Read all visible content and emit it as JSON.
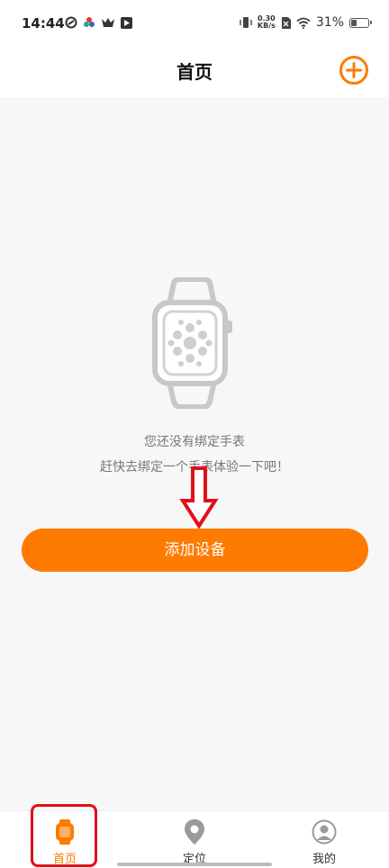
{
  "status_bar": {
    "time": "14:44",
    "net_speed_value": "0.30",
    "net_speed_unit": "KB/s",
    "battery": "31%"
  },
  "header": {
    "title": "首页",
    "add_icon": "plus-circle-icon"
  },
  "empty_state": {
    "watch_icon": "smartwatch-icon",
    "line1": "您还没有绑定手表",
    "line2": "赶快去绑定一个手表体验一下吧！"
  },
  "actions": {
    "add_device_label": "添加设备"
  },
  "tabbar": {
    "tabs": [
      {
        "label": "首页",
        "icon": "watch-icon",
        "active": true
      },
      {
        "label": "定位",
        "icon": "location-pin-icon",
        "active": false
      },
      {
        "label": "我的",
        "icon": "user-icon",
        "active": false
      }
    ]
  },
  "colors": {
    "accent": "#ff7a00",
    "annotation": "#e0101a"
  }
}
